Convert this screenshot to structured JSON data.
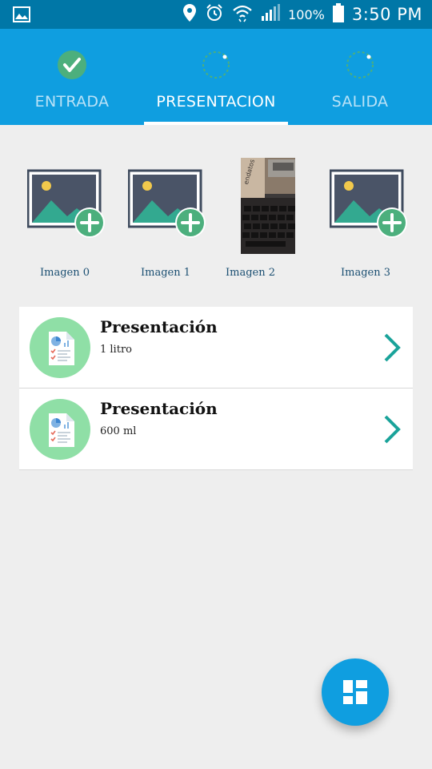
{
  "status_bar": {
    "battery": "100%",
    "time": "3:50 PM",
    "icons": [
      "gallery-notification-icon",
      "location-icon",
      "alarm-icon",
      "wifi-icon",
      "signal-icon",
      "battery-icon"
    ]
  },
  "tabs": [
    {
      "label": "ENTRADA",
      "state": "completed",
      "icon": "check-circle-icon"
    },
    {
      "label": "PRESENTACION",
      "state": "active",
      "icon": "progress-ring-icon"
    },
    {
      "label": "SALIDA",
      "state": "pending",
      "icon": "progress-ring-icon"
    }
  ],
  "gallery": [
    {
      "label": "Imagen 0",
      "kind": "placeholder",
      "icon": "add-image-icon"
    },
    {
      "label": "Imagen 1",
      "kind": "placeholder",
      "icon": "add-image-icon"
    },
    {
      "label": "Imagen 2",
      "kind": "photo",
      "photo_text": "endatos"
    },
    {
      "label": "Imagen 3",
      "kind": "placeholder",
      "icon": "add-image-icon"
    }
  ],
  "items": [
    {
      "title": "Presentación",
      "subtitle": "1 litro",
      "icon": "report-document-icon"
    },
    {
      "title": "Presentación",
      "subtitle": "600 ml",
      "icon": "report-document-icon"
    }
  ],
  "fab": {
    "icon": "dashboard-grid-icon"
  },
  "colors": {
    "status_bar": "#0077a7",
    "primary": "#0f9ee0",
    "accent_green": "#4caf7d",
    "chevron": "#1aa39a",
    "background": "#eeeeee"
  }
}
